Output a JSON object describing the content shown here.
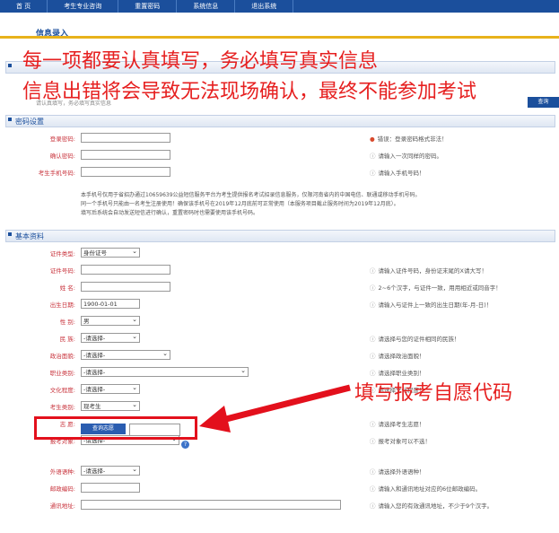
{
  "nav": [
    "首 页",
    "考生专业咨询",
    "重置密码",
    "系统信息",
    "退出系统"
  ],
  "title": "信息录入",
  "annotation_line1": "每一项都要认真填写，务必填写真实信息",
  "annotation_line2": "信息出错将会导致无法现场确认，最终不能参加考试",
  "annotation_arrow": "填写报考自愿代码",
  "query_btn": "查询",
  "sections": {
    "password": "密码设置",
    "basic": "基本资料"
  },
  "password_rows": [
    {
      "label": "登录密码:",
      "hint": "错误：登录密码格式非法！",
      "err": true
    },
    {
      "label": "确认密码:",
      "hint": "请输入一次同样的密码。"
    },
    {
      "label": "考生手机号码:",
      "hint": "请输入手机号码！"
    }
  ],
  "notes": [
    "本手机号仅用于省招办通过10659639公益短信服务平台为考生提供报名考试招录信息服务，仅限河南省内的中国电信、联通或移动手机号码。",
    "同一个手机号只能由一名考生注册使用！确保该手机号在2019年12月底前可正常使用（本服务项目截止服务时间为2019年12月底）。",
    "填写后系统会自动发送短信进行确认，重置密码时也需要使用该手机号码。"
  ],
  "basic_rows": [
    {
      "label": "证件类型:",
      "value": "身份证号",
      "sel": true,
      "w": 66,
      "hint": ""
    },
    {
      "label": "证件号码:",
      "value": "",
      "w": 100,
      "hint": "请输入证件号码，身份证末尾的X请大写！"
    },
    {
      "label": "姓  名:",
      "value": "",
      "w": 100,
      "hint": "2~6个汉字，与证件一致，用用相近或同音字！"
    },
    {
      "label": "出生日期:",
      "value": "1900-01-01",
      "w": 66,
      "hint": "请输入与证件上一致的出生日期(年-月-日)！"
    },
    {
      "label": "性  别:",
      "value": "男",
      "sel": true,
      "w": 66,
      "hint": ""
    },
    {
      "label": "民  族:",
      "value": "-请选择-",
      "sel": true,
      "w": 66,
      "hint": "请选择与您的证件相同的民族！"
    },
    {
      "label": "政治面貌:",
      "value": "-请选择-",
      "sel": true,
      "w": 100,
      "hint": "请选择政治面貌！"
    },
    {
      "label": "职业类别:",
      "value": "-请选择-",
      "sel": true,
      "w": 187,
      "hint": "请选择职业类别！"
    },
    {
      "label": "文化程度:",
      "value": "-请选择-",
      "sel": true,
      "w": 66,
      "hint": "请选择文化程度！"
    },
    {
      "label": "考生类别:",
      "value": "现考生",
      "sel": true,
      "w": 66,
      "hint": ""
    },
    {
      "label": "志  愿:",
      "value": "",
      "w": 0,
      "hint": "请选择考生志愿！"
    },
    {
      "label": "报考对象:",
      "value": "-请选择-",
      "sel": true,
      "w": 110,
      "hint": "报考对象可以不选！"
    },
    {
      "label": "外语语种:",
      "value": "-请选择-",
      "sel": true,
      "w": 66,
      "hint": "请选择外语语种！"
    },
    {
      "label": "邮政编码:",
      "value": "",
      "w": 66,
      "hint": "请输入和通讯地址对应的6位邮政编码。"
    },
    {
      "label": "通讯地址:",
      "value": "",
      "w": 290,
      "hint": "请输入您的有效通讯地址，不少于9个汉字。"
    }
  ],
  "zy_btn": "查询志愿",
  "small_note": "请认真填写，务必填写真实信息",
  "colors": {
    "nav": "#1b4f9c",
    "annotation": "#e62020",
    "accent": "#e8b21b"
  }
}
